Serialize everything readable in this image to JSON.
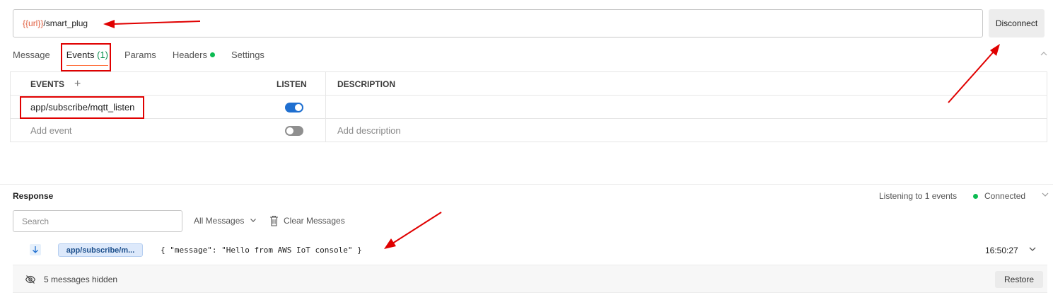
{
  "request": {
    "url_variable": "{{url}}",
    "url_path": "/smart_plug",
    "disconnect_label": "Disconnect"
  },
  "tabs": [
    {
      "label": "Message"
    },
    {
      "label": "Events",
      "count": "(1)",
      "active": true
    },
    {
      "label": "Params"
    },
    {
      "label": "Headers",
      "indicator": "green-dot"
    },
    {
      "label": "Settings"
    }
  ],
  "events_table": {
    "headers": {
      "events": "EVENTS",
      "listen": "LISTEN",
      "description": "DESCRIPTION"
    },
    "rows": [
      {
        "event": "app/subscribe/mqtt_listen",
        "listen": true,
        "description": ""
      }
    ],
    "new_row": {
      "event_placeholder": "Add event",
      "listen": false,
      "description_placeholder": "Add description"
    }
  },
  "response": {
    "title": "Response",
    "listening_text": "Listening to 1 events",
    "status": "Connected",
    "search_placeholder": "Search",
    "filter_label": "All Messages",
    "clear_label": "Clear Messages",
    "messages": [
      {
        "direction": "incoming",
        "topic": "app/subscribe/m...",
        "body": "{ \"message\": \"Hello from AWS IoT console\" }",
        "time": "16:50:27"
      }
    ],
    "hidden_text": "5 messages hidden",
    "restore_label": "Restore"
  },
  "colors": {
    "accent": "#ff6c37",
    "variable": "#e05d3d",
    "toggle_on": "#1f6fd0",
    "connected": "#0cbb52",
    "annotation": "#e00000"
  }
}
